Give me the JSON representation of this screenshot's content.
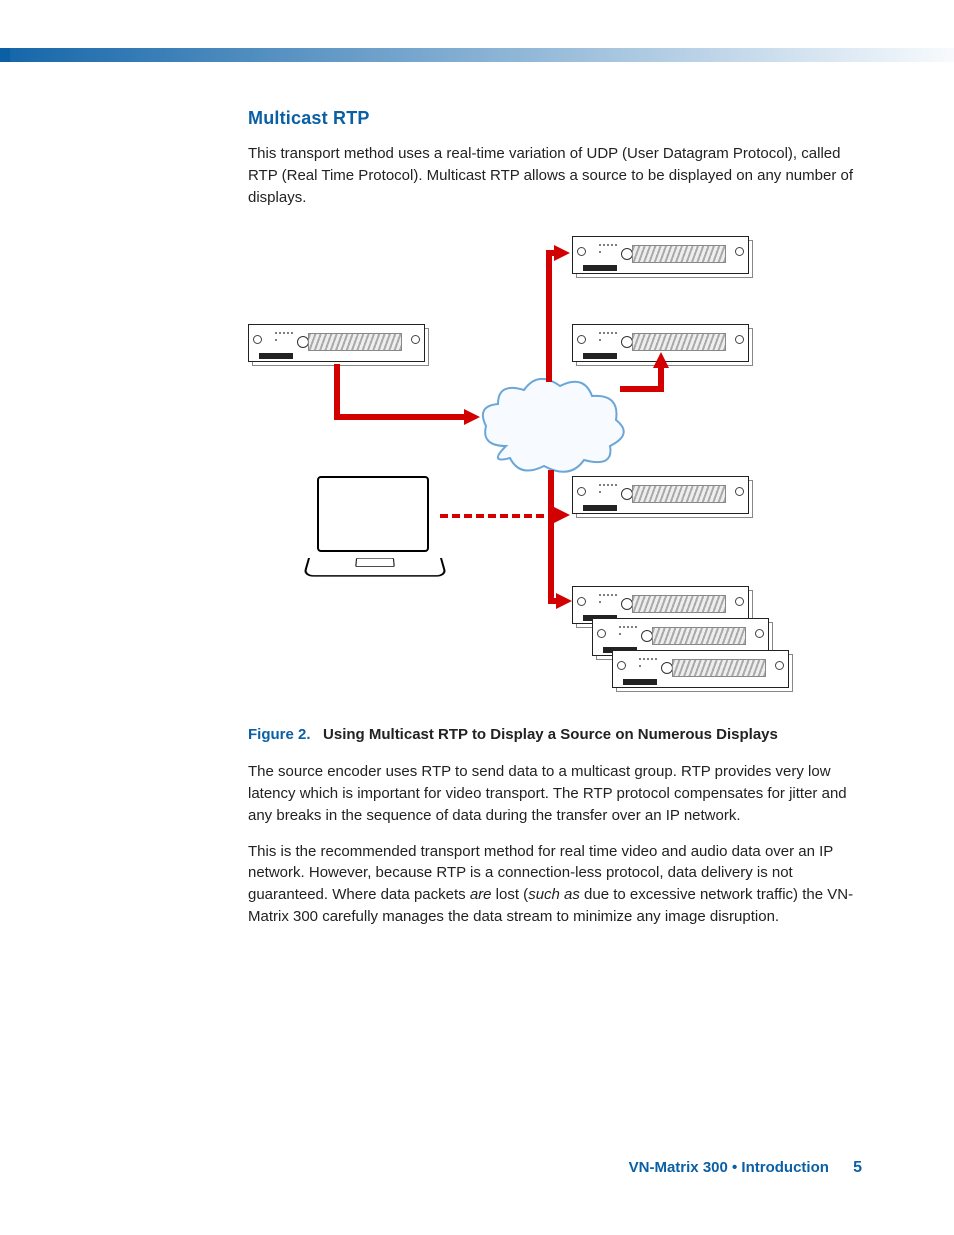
{
  "section": {
    "heading": "Multicast RTP"
  },
  "paragraphs": {
    "p1": "This transport method uses a real-time variation of UDP (User Datagram Protocol), called RTP (Real Time Protocol). Multicast RTP allows a source to be displayed on any number of displays.",
    "p2": "The source encoder uses RTP to send data to a multicast group. RTP provides very low latency which is important for video transport. The RTP protocol compensates for jitter and any breaks in the sequence of data during the transfer over an IP network.",
    "p3a": "This is the recommended transport method for real time video and audio data over an IP network. However, because RTP is a connection-less protocol, data delivery is not guaranteed. Where data packets ",
    "p3_em1": "are",
    "p3b": " lost (",
    "p3_em2": "such as",
    "p3c": " due to excessive network traffic) the VN-Matrix 300 carefully manages the data stream to minimize any image disruption."
  },
  "figure": {
    "number": "Figure 2.",
    "title": "Using Multicast RTP to Display a Source on Numerous Displays",
    "components": {
      "source_encoder": "Extron rack device (source)",
      "decoders": [
        "top-right device",
        "upper-right device",
        "middle-right device",
        "bottom-right device stack (3 units)"
      ],
      "network": "IP network cloud",
      "controller": "Laptop (dashed control link)"
    }
  },
  "footer": {
    "crumb": "VN-Matrix 300 • Introduction",
    "page_number": "5"
  },
  "colors": {
    "accent": "#0a5fa5",
    "arrow": "#d20000"
  }
}
